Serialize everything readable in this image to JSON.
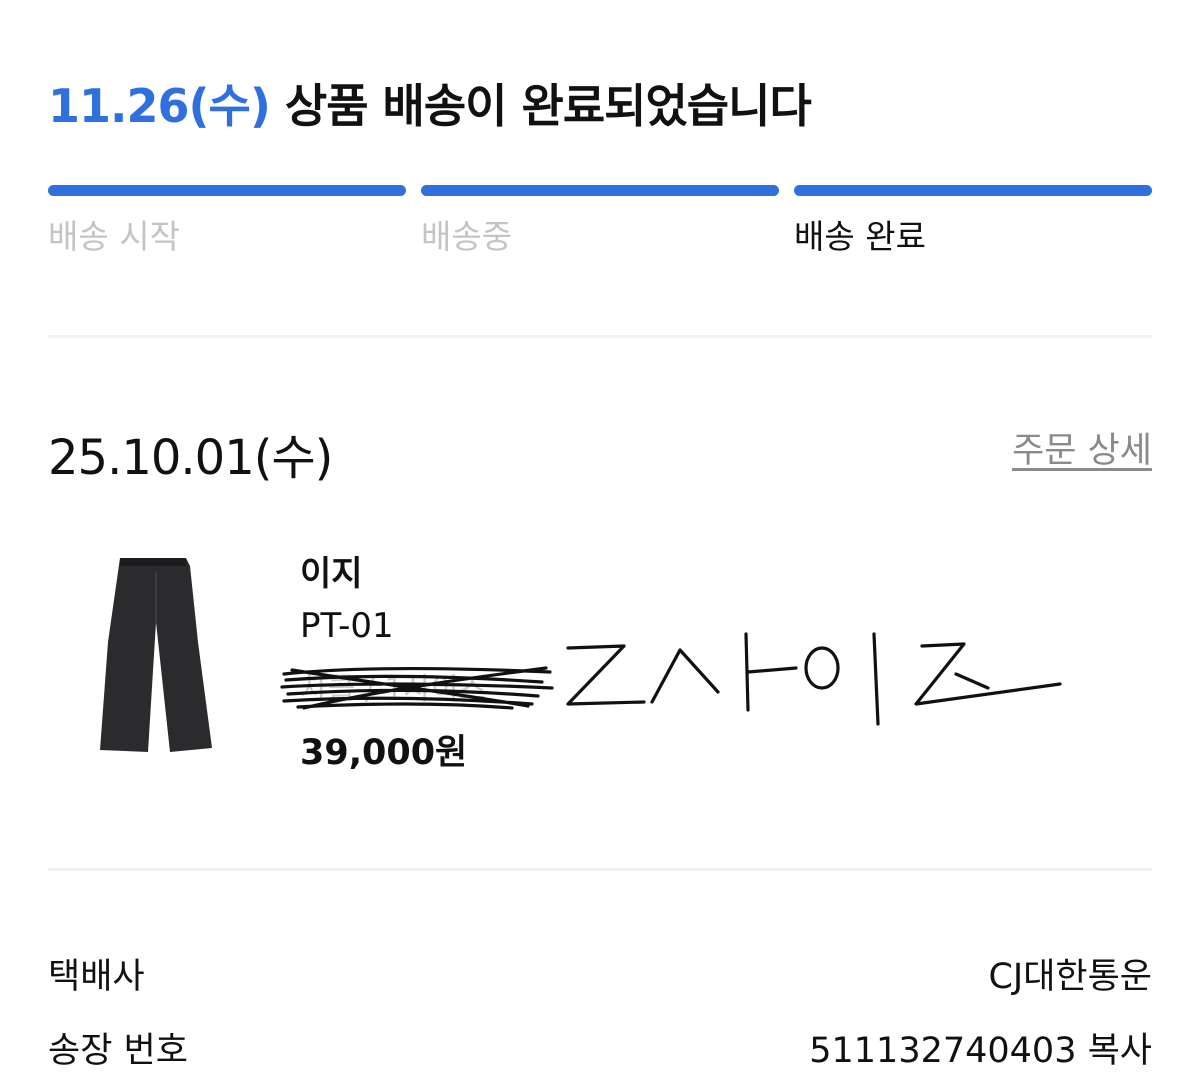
{
  "header": {
    "delivery_date": "11.26(수)",
    "message": " 상품 배송이 완료되었습니다"
  },
  "progress": {
    "steps": [
      {
        "label": "배송 시작"
      },
      {
        "label": "배송중"
      },
      {
        "label": "배송 완료"
      }
    ],
    "accent_color": "#2f6fde"
  },
  "order": {
    "date": "25.10.01(수)",
    "detail_link": "주문 상세",
    "item": {
      "brand": "이지",
      "name": "PT-01",
      "option": "차콜 / 1사이즈",
      "price": "39,000원",
      "handwritten_note": "2사이즈"
    }
  },
  "shipping": {
    "carrier_label": "택배사",
    "carrier_value": "CJ대한통운",
    "tracking_label": "송장 번호",
    "tracking_value": "511132740403 복사"
  }
}
